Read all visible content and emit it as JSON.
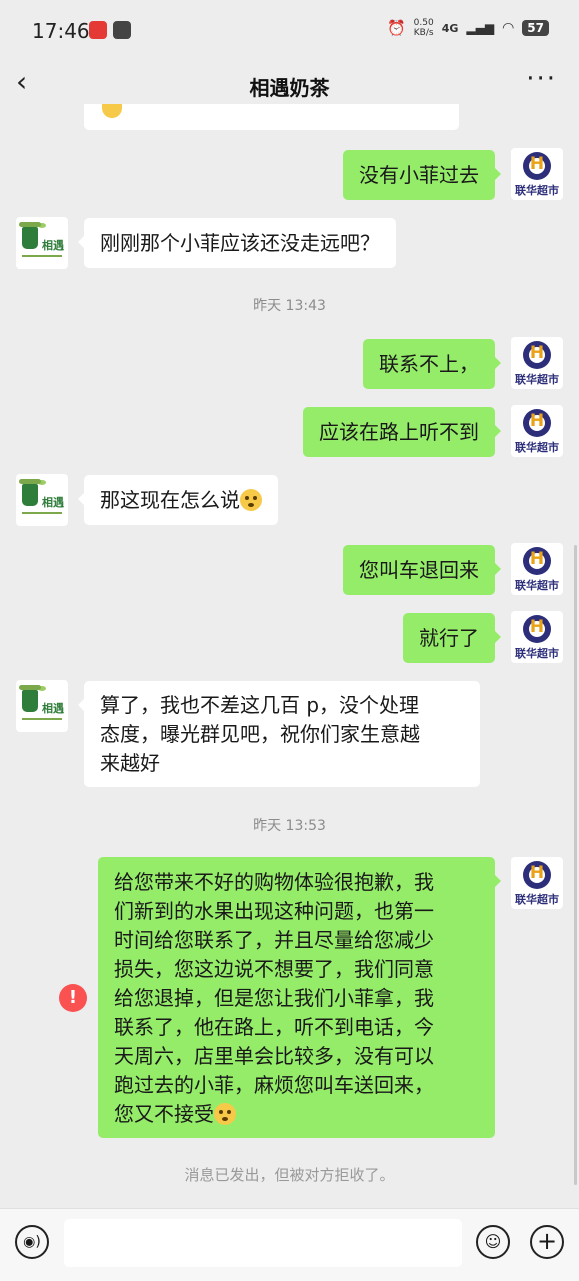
{
  "status_bar": {
    "time": "17:46",
    "net_speed": "0.50",
    "net_unit": "KB/s",
    "network": "4G",
    "battery": "57"
  },
  "header": {
    "title": "相遇奶茶",
    "back_icon": "‹",
    "more_icon": "···"
  },
  "avatars": {
    "shop_label": "联华超市",
    "shop_letter": "H",
    "tea_label": "相遇"
  },
  "messages": [
    {
      "side": "right",
      "text": "没有小菲过去"
    },
    {
      "side": "left",
      "text": "刚刚那个小菲应该还没走远吧？"
    },
    {
      "type": "time",
      "text": "昨天 13:43"
    },
    {
      "side": "right",
      "text": "联系不上，"
    },
    {
      "side": "right",
      "text": "应该在路上听不到"
    },
    {
      "side": "left",
      "text": "那这现在怎么说"
    },
    {
      "side": "right",
      "text": "您叫车退回来"
    },
    {
      "side": "right",
      "text": "就行了"
    },
    {
      "side": "left",
      "lines": [
        "算了，我也不差这几百 p，没个处理",
        "态度，曝光群见吧，祝你们家生意越",
        "来越好"
      ]
    },
    {
      "type": "time",
      "text": "昨天 13:53"
    },
    {
      "side": "right",
      "lines": [
        "给您带来不好的购物体验很抱歉，我",
        "们新到的水果出现这种问题，也第一",
        "时间给您联系了，并且尽量给您减少",
        "损失，您这边说不想要了，我们同意",
        "给您退掉，但是您让我们小菲拿，我",
        "联系了，他在路上，听不到电话，今",
        "天周六，店里单会比较多，没有可以",
        "跑过去的小菲，麻烦您叫车送回来，",
        "您又不接受"
      ]
    }
  ],
  "error_icon": "!",
  "system_notice": "消息已发出，但被对方拒收了。",
  "input_bar": {
    "voice_icon": "voice-icon",
    "emoji_icon": "emoji-icon",
    "plus_icon": "+"
  }
}
